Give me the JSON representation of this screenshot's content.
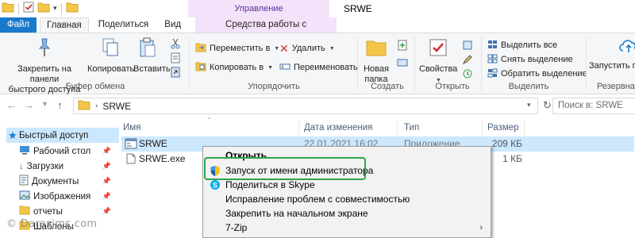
{
  "window": {
    "title": "SRWE",
    "context_group": "Управление"
  },
  "tabs": [
    {
      "label": "Файл"
    },
    {
      "label": "Главная"
    },
    {
      "label": "Поделиться"
    },
    {
      "label": "Вид"
    },
    {
      "label": "Средства работы с приложениями"
    }
  ],
  "ribbon": {
    "clipboard": {
      "pin": "Закрепить на панели быстрого доступа",
      "pin_line1": "Закрепить на панели",
      "pin_line2": "быстрого доступа",
      "copy": "Копировать",
      "paste": "Вставить",
      "label": "Буфер обмена"
    },
    "organize": {
      "move": "Переместить в",
      "copy_to": "Копировать в",
      "delete": "Удалить",
      "rename": "Переименовать",
      "label": "Упорядочить"
    },
    "create": {
      "new_folder_line1": "Новая",
      "new_folder_line2": "папка",
      "label": "Создать"
    },
    "open": {
      "properties": "Свойства",
      "label": "Открыть"
    },
    "select": {
      "select_all": "Выделить все",
      "select_none": "Снять выделение",
      "invert": "Обратить выделение",
      "label": "Выделить"
    },
    "backup": {
      "run_line1": "Запустить п",
      "label": "Резервна"
    }
  },
  "address": {
    "path": "SRWE",
    "search_placeholder": "Поиск в: SRWE"
  },
  "nav_pane": {
    "items": [
      {
        "label": "Быстрый доступ"
      },
      {
        "label": "Рабочий стол"
      },
      {
        "label": "Загрузки"
      },
      {
        "label": "Документы"
      },
      {
        "label": "Изображения"
      },
      {
        "label": "отчеты"
      },
      {
        "label": "Шаблоны"
      }
    ]
  },
  "columns": {
    "name": "Имя",
    "date": "Дата изменения",
    "type": "Тип",
    "size": "Размер"
  },
  "files": [
    {
      "name": "SRWE",
      "date": "22.01.2021 16:02",
      "type": "Приложение",
      "size": "209 КБ"
    },
    {
      "name": "SRWE.exe",
      "date": "",
      "type": "",
      "size": "1 КБ"
    }
  ],
  "context_menu": {
    "items": [
      {
        "label": "Открыть"
      },
      {
        "label": "Запуск от имени администратора"
      },
      {
        "label": "Поделиться в Skype"
      },
      {
        "label": "Исправление проблем с совместимостью"
      },
      {
        "label": "Закрепить на начальном экране"
      },
      {
        "label": "7-Zip"
      }
    ]
  },
  "watermark": "© Darasims.com",
  "colors": {
    "accent": "#1979ca",
    "selection": "#cce8ff",
    "context_tab": "#f4e2fb",
    "highlight_box": "#2ea44f"
  }
}
